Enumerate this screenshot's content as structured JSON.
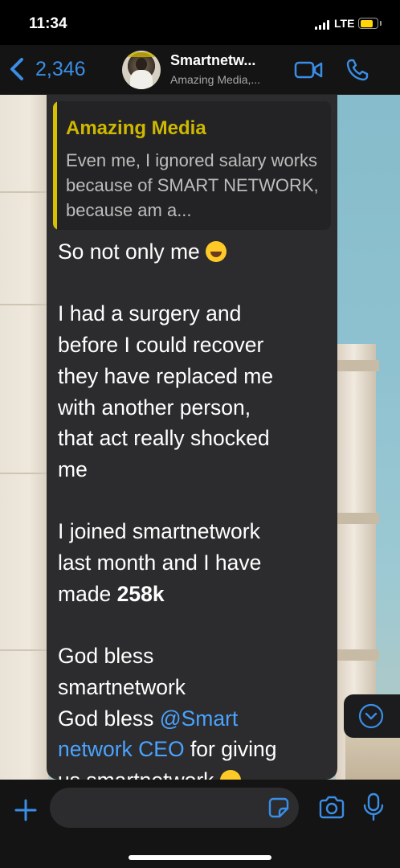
{
  "status_bar": {
    "time": "11:34",
    "network": "LTE",
    "battery_level": 0.75
  },
  "header": {
    "back_count": "2,346",
    "chat_name": "Smartnetw...",
    "chat_subtitle": "Amazing Media,..."
  },
  "message": {
    "quoted": {
      "author": "Amazing Media",
      "text": "Even me, I ignored salary works because of SMART NETWORK, because am a..."
    },
    "lines": {
      "l1": "So not only me",
      "l2": "I had a surgery and",
      "l3": "before I could recover",
      "l4": "they have replaced me",
      "l5": "with another person,",
      "l6": "that act really shocked",
      "l7": "me",
      "l8": "I joined smartnetwork",
      "l9": "last month and I have",
      "l10_prefix": "made ",
      "l10_bold": "258k",
      "l11": "God bless",
      "l12": "smartnetwork",
      "l13_prefix": "God bless ",
      "l13_mention": "@Smart",
      "l14_mention": "network CEO",
      "l14_suffix": " for giving",
      "l15": "us smartnetwork"
    },
    "emojis": {
      "laugh": "crying-laughing-emoji",
      "heart_eyes": "heart-eyes-emoji"
    }
  },
  "input": {
    "placeholder": ""
  },
  "colors": {
    "accent": "#3a8ee6",
    "quote_author": "#cfb900",
    "mention": "#4aa3ff",
    "bubble": "#2c2c2e",
    "battery": "#ffd60a"
  }
}
